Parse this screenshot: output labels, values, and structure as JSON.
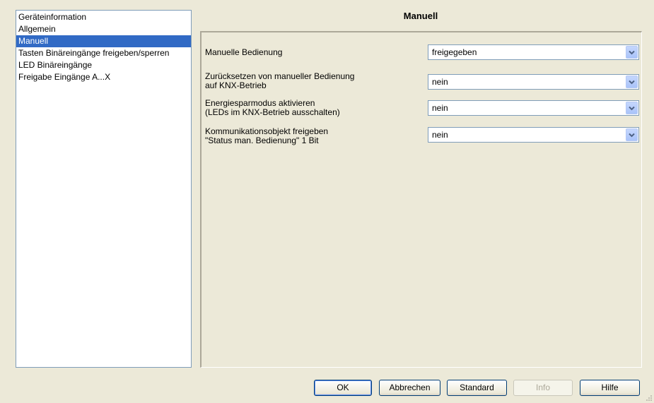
{
  "sidebar": {
    "items": [
      {
        "label": "Geräteinformation",
        "selected": false
      },
      {
        "label": "Allgemein",
        "selected": false
      },
      {
        "label": "Manuell",
        "selected": true
      },
      {
        "label": "Tasten Binäreingänge freigeben/sperren",
        "selected": false
      },
      {
        "label": "LED Binäreingänge",
        "selected": false
      },
      {
        "label": "Freigabe Eingänge A...X",
        "selected": false
      }
    ]
  },
  "main": {
    "title": "Manuell",
    "params": [
      {
        "label_line1": "Manuelle Bedienung",
        "label_line2": "",
        "value": "freigegeben"
      },
      {
        "label_line1": "Zurücksetzen von manueller Bedienung",
        "label_line2": "auf KNX-Betrieb",
        "value": "nein"
      },
      {
        "label_line1": "Energiesparmodus aktivieren",
        "label_line2": "(LEDs im KNX-Betrieb ausschalten)",
        "value": "nein"
      },
      {
        "label_line1": "Kommunikationsobjekt freigeben",
        "label_line2": "\"Status man. Bedienung\" 1 Bit",
        "value": "nein"
      }
    ]
  },
  "buttons": {
    "ok": "OK",
    "cancel": "Abbrechen",
    "standard": "Standard",
    "info": "Info",
    "help": "Hilfe"
  },
  "colors": {
    "selection": "#316ac5",
    "background": "#ece9d8",
    "field_border": "#7f9db9"
  }
}
